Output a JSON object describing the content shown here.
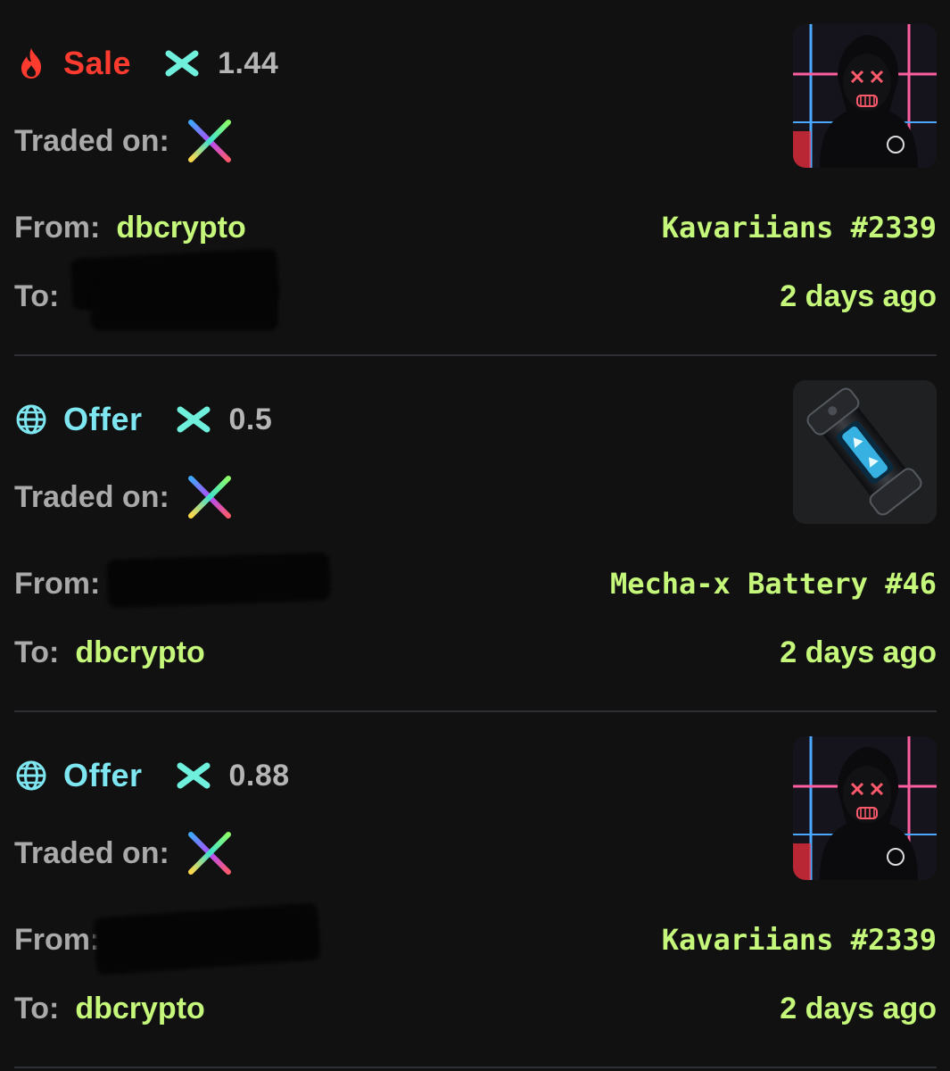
{
  "colors": {
    "background": "#111111",
    "sale": "#ff3b30",
    "offer": "#7ee6f0",
    "highlight": "#c5f77a",
    "label": "#a9a9a9",
    "price": "#b5b5b5"
  },
  "icons": {
    "sale": "flame-icon",
    "offer": "globe-icon",
    "currency": "imx-icon",
    "marketplace": "rainbow-x-marketplace-icon"
  },
  "labels": {
    "traded_on": "Traded on:",
    "from": "From:",
    "to": "To:"
  },
  "transactions": [
    {
      "type": "Sale",
      "price": "1.44",
      "from_user": "dbcrypto",
      "to_user": "",
      "item_name": "Kavariians #2339",
      "time_ago": "2 days ago",
      "thumbnail": "hooded-figure-avatar"
    },
    {
      "type": "Offer",
      "price": "0.5",
      "from_user": "",
      "to_user": "dbcrypto",
      "item_name": "Mecha-x Battery #46",
      "time_ago": "2 days ago",
      "thumbnail": "battery-cell"
    },
    {
      "type": "Offer",
      "price": "0.88",
      "from_user": "",
      "to_user": "dbcrypto",
      "item_name": "Kavariians #2339",
      "time_ago": "2 days ago",
      "thumbnail": "hooded-figure-avatar"
    }
  ]
}
